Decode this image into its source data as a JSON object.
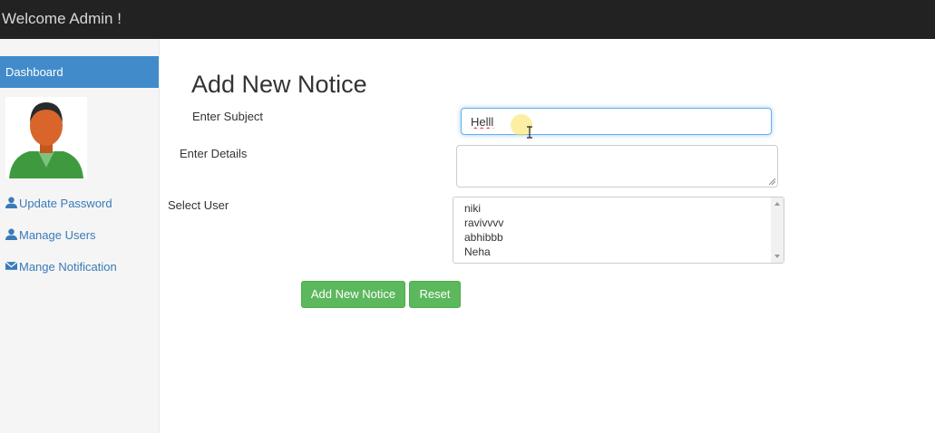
{
  "header": {
    "title": "Welcome Admin !"
  },
  "sidebar": {
    "active": "Dashboard",
    "items": [
      {
        "label": "Update Password",
        "icon": "user-icon"
      },
      {
        "label": "Manage Users",
        "icon": "user-icon"
      },
      {
        "label": "Mange Notification",
        "icon": "envelope-icon"
      }
    ]
  },
  "form": {
    "title": "Add New Notice",
    "subject_label": "Enter Subject",
    "subject_value": "Helll",
    "details_label": "Enter Details",
    "details_value": "",
    "user_label": "Select User",
    "users": [
      "niki",
      "ravivvvv",
      "abhibbb",
      "Neha"
    ],
    "submit_label": "Add New Notice",
    "reset_label": "Reset"
  },
  "colors": {
    "accent": "#428bca",
    "button": "#5cb85c",
    "topbar": "#222222"
  }
}
